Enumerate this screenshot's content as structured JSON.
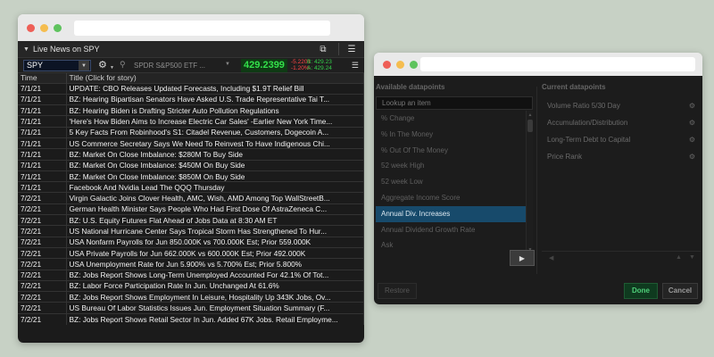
{
  "news_window": {
    "header": {
      "title": "Live News on SPY"
    },
    "quote": {
      "symbol": "SPY",
      "name": "SPDR S&P500 ETF ...",
      "price": "429.2399",
      "change": "-5.2201",
      "change_pct": "-1.20%",
      "bid": "B: 429.23",
      "ask": "A: 429.24"
    },
    "columns": [
      "Time",
      "Title (Click for story)"
    ],
    "rows": [
      {
        "time": "7/1/21",
        "title": "UPDATE: CBO Releases Updated Forecasts, Including $1.9T Relief Bill"
      },
      {
        "time": "7/1/21",
        "title": "BZ: Hearing Bipartisan Senators Have Asked U.S. Trade Representative Tai T..."
      },
      {
        "time": "7/1/21",
        "title": "BZ: Hearing Biden is Drafting Stricter Auto Pollution Regulations"
      },
      {
        "time": "7/1/21",
        "title": "'Here's How Biden Aims to Increase Electric Car Sales' -Earlier New York Time..."
      },
      {
        "time": "7/1/21",
        "title": "5 Key Facts From Robinhood's S1: Citadel Revenue, Customers, Dogecoin A..."
      },
      {
        "time": "7/1/21",
        "title": "US Commerce Secretary Says We Need To Reinvest To Have Indigenous Chi..."
      },
      {
        "time": "7/1/21",
        "title": "BZ: Market On Close Imbalance: $280M To Buy Side"
      },
      {
        "time": "7/1/21",
        "title": "BZ: Market On Close Imbalance: $450M On Buy Side"
      },
      {
        "time": "7/1/21",
        "title": "BZ: Market On Close Imbalance: $850M On Buy Side"
      },
      {
        "time": "7/1/21",
        "title": "Facebook And Nvidia Lead The QQQ Thursday"
      },
      {
        "time": "7/2/21",
        "title": "Virgin Galactic Joins Clover Health, AMC, Wish, AMD Among Top WallStreetB..."
      },
      {
        "time": "7/2/21",
        "title": "German Health Minister Says  People Who Had First Dose Of AstraZeneca C..."
      },
      {
        "time": "7/2/21",
        "title": "BZ: U.S. Equity Futures Flat Ahead of Jobs Data at 8:30 AM ET"
      },
      {
        "time": "7/2/21",
        "title": "US National Hurricane Center Says Tropical Storm Has Strengthened To Hur..."
      },
      {
        "time": "7/2/21",
        "title": "USA Nonfarm Payrolls for Jun 850.000K vs 700.000K Est; Prior 559.000K"
      },
      {
        "time": "7/2/21",
        "title": "USA Private Payrolls for Jun 662.000K vs 600.000K Est; Prior 492.000K"
      },
      {
        "time": "7/2/21",
        "title": "USA Unemployment Rate for Jun 5.900% vs 5.700% Est; Prior 5.800%"
      },
      {
        "time": "7/2/21",
        "title": "BZ: Jobs Report Shows Long-Term Unemployed Accounted For 42.1% Of Tot..."
      },
      {
        "time": "7/2/21",
        "title": "BZ: Labor Force Participation Rate In Jun. Unchanged At 61.6%"
      },
      {
        "time": "7/2/21",
        "title": "BZ: Jobs Report Shows Employment In Leisure, Hospitality Up 343K Jobs, Ov..."
      },
      {
        "time": "7/2/21",
        "title": "US Bureau Of Labor Statistics Issues Jun. Employment Situation Summary (F..."
      },
      {
        "time": "7/2/21",
        "title": "BZ: Jobs Report Shows Retail Sector In Jun. Added 67K Jobs. Retail Employme..."
      }
    ]
  },
  "datapoints_window": {
    "available_label": "Available datapoints",
    "current_label": "Current datapoints",
    "lookup_placeholder": "Lookup an item",
    "available": [
      "% Change",
      "% In The Money",
      "% Out Of The Money",
      "52 week High",
      "52 week Low",
      "Aggregate Income Score",
      "Annual Div. Increases",
      "Annual Dividend Growth Rate",
      "Ask"
    ],
    "selected_index": 6,
    "current": [
      "Volume Ratio 5/30 Day",
      "Accumulation/Distribution",
      "Long-Term Debt to Capital",
      "Price Rank"
    ],
    "restore_label": "Restore",
    "done_label": "Done",
    "cancel_label": "Cancel"
  }
}
